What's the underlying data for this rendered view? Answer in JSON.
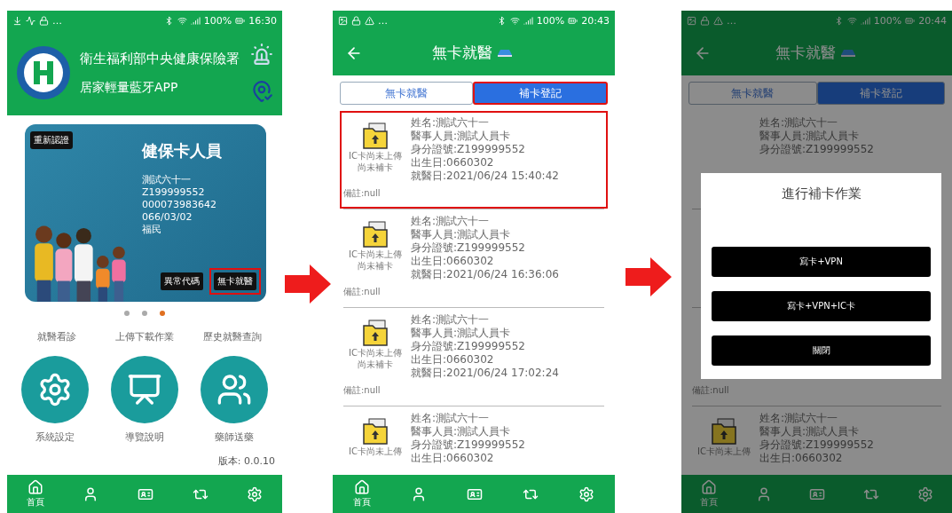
{
  "screens": [
    {
      "kind": "home",
      "status": {
        "left": "…",
        "battery": "100%",
        "time": "16:30"
      },
      "header": {
        "title": "衛生福利部中央健康保險署",
        "subtitle": "居家輕量藍牙APP"
      },
      "card": {
        "badge": "重新認證",
        "title": "健保卡人員",
        "lines": [
          "測試六十一",
          "Z199999552",
          "000073983642",
          "066/03/02",
          "福民"
        ],
        "buttons": [
          {
            "label": "異常代碼",
            "highlighted": false
          },
          {
            "label": "無卡就醫",
            "highlighted": true
          }
        ]
      },
      "pager": [
        {
          "selected": false
        },
        {
          "selected": false
        },
        {
          "selected": true
        }
      ],
      "menu_labels": [
        "就醫看診",
        "上傳下載作業",
        "歷史就醫查詢"
      ],
      "tiles": [
        {
          "kind": "settings",
          "label": "系統設定"
        },
        {
          "kind": "guide",
          "label": "導覽說明"
        },
        {
          "kind": "pharmacist",
          "label": "藥師送藥"
        }
      ],
      "version": "版本: 0.0.10",
      "nav": [
        {
          "kind": "home",
          "label": "首頁"
        },
        {
          "kind": "doctor"
        },
        {
          "kind": "card"
        },
        {
          "kind": "sync"
        },
        {
          "kind": "settings"
        }
      ]
    },
    {
      "kind": "list",
      "status": {
        "left": "…",
        "battery": "100%",
        "time": "20:43"
      },
      "app_bar": {
        "title": "無卡就醫"
      },
      "tabs": [
        {
          "label": "無卡就醫",
          "selected": false,
          "highlighted": false
        },
        {
          "label": "補卡登記",
          "selected": true,
          "highlighted": true
        }
      ],
      "records": [
        {
          "highlighted": true,
          "status": [
            "IC卡尚未上傳",
            "尚未補卡"
          ],
          "fields": [
            "姓名:測試六十一",
            "醫事人員:測試人員卡",
            "身分證號:Z199999552",
            "出生日:0660302",
            "就醫日:2021/06/24 15:40:42"
          ],
          "remark": "備註:null"
        },
        {
          "highlighted": false,
          "status": [
            "IC卡尚未上傳",
            "尚未補卡"
          ],
          "fields": [
            "姓名:測試六十一",
            "醫事人員:測試人員卡",
            "身分證號:Z199999552",
            "出生日:0660302",
            "就醫日:2021/06/24 16:36:06"
          ],
          "remark": "備註:null"
        },
        {
          "highlighted": false,
          "status": [
            "IC卡尚未上傳",
            "尚未補卡"
          ],
          "fields": [
            "姓名:測試六十一",
            "醫事人員:測試人員卡",
            "身分證號:Z199999552",
            "出生日:0660302",
            "就醫日:2021/06/24 17:02:24"
          ],
          "remark": "備註:null"
        },
        {
          "highlighted": false,
          "status": [
            "IC卡尚未上傳"
          ],
          "fields": [
            "姓名:測試六十一",
            "醫事人員:測試人員卡",
            "身分證號:Z199999552",
            "出生日:0660302"
          ]
        }
      ],
      "nav": [
        {
          "kind": "home",
          "label": "首頁"
        },
        {
          "kind": "doctor"
        },
        {
          "kind": "card"
        },
        {
          "kind": "sync"
        },
        {
          "kind": "settings"
        }
      ]
    },
    {
      "kind": "list",
      "dimmed": true,
      "status": {
        "left": "…",
        "battery": "100%",
        "time": "20:44"
      },
      "app_bar": {
        "title": "無卡就醫"
      },
      "tabs": [
        {
          "label": "無卡就醫",
          "selected": false,
          "highlighted": false
        },
        {
          "label": "補卡登記",
          "selected": true,
          "highlighted": false
        }
      ],
      "records": [
        {
          "highlighted": false,
          "fields": [
            "姓名:測試六十一",
            "醫事人員:測試人員卡",
            "身分證號:Z199999552"
          ]
        },
        {
          "highlighted": false
        },
        {
          "highlighted": false,
          "remark": "備註:null"
        },
        {
          "highlighted": false,
          "status": [
            "IC卡尚未上傳"
          ],
          "fields": [
            "姓名:測試六十一",
            "醫事人員:測試人員卡",
            "身分證號:Z199999552",
            "出生日:0660302"
          ]
        }
      ],
      "dialog": {
        "title": "進行補卡作業",
        "buttons": [
          "寫卡+VPN",
          "寫卡+VPN+IC卡",
          "關閉"
        ]
      },
      "nav": [
        {
          "kind": "home",
          "label": "首頁"
        },
        {
          "kind": "doctor"
        },
        {
          "kind": "card"
        },
        {
          "kind": "sync"
        },
        {
          "kind": "settings"
        }
      ]
    }
  ]
}
